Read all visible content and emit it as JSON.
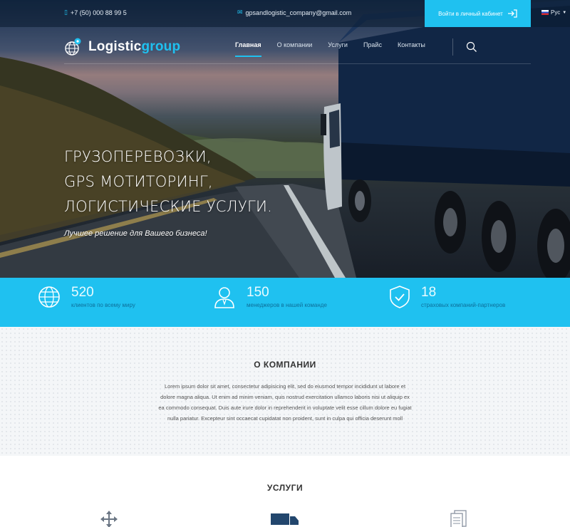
{
  "topbar": {
    "phone": "+7 (50) 000 88 99 5",
    "email": "gpsandlogistic_company@gmail.com",
    "login_label": "Войти в личный кабинет",
    "lang": "Рус"
  },
  "logo": {
    "part1": "Logistic",
    "part2": "group"
  },
  "nav": {
    "items": [
      {
        "label": "Главная"
      },
      {
        "label": "О компании"
      },
      {
        "label": "Услуги"
      },
      {
        "label": "Прайс"
      },
      {
        "label": "Контакты"
      }
    ]
  },
  "hero": {
    "lines": [
      "ГРУЗОПЕРЕВОЗКИ,",
      "GPS МОТИТОРИНГ,",
      "ЛОГИСТИЧЕСКИЕ УСЛУГИ."
    ],
    "subtitle": "Лучшее решение для Вашего бизнеса!"
  },
  "stats": [
    {
      "value": "520",
      "label": "клиентов по всему миру",
      "icon": "globe-icon"
    },
    {
      "value": "150",
      "label": "менеджеров в нашей команде",
      "icon": "manager-icon"
    },
    {
      "value": "18",
      "label": "страховых компаний-партнеров",
      "icon": "shield-check-icon"
    }
  ],
  "about": {
    "title": "О КОМПАНИИ",
    "text": "Lorem ipsum dolor sit amet, consectetur adipisicing elit, sed do eiusmod tempor incididunt ut labore et dolore magna aliqua. Ut enim ad minim veniam, quis nostrud exercitation ullamco laboris nisi ut aliquip ex ea commodo consequat. Duis aute irure dolor in reprehenderit in voluptate velit esse cillum dolore eu fugiat nulla pariatur. Excepteur sint occaecat cupidatat non proident, sunt in culpa qui officia deserunt moll"
  },
  "services": {
    "title": "УСЛУГИ",
    "icons": [
      "move-arrows-icon",
      "truck-icon",
      "documents-icon"
    ]
  },
  "colors": {
    "accent": "#1fc1f0",
    "dark": "#0d2740"
  }
}
